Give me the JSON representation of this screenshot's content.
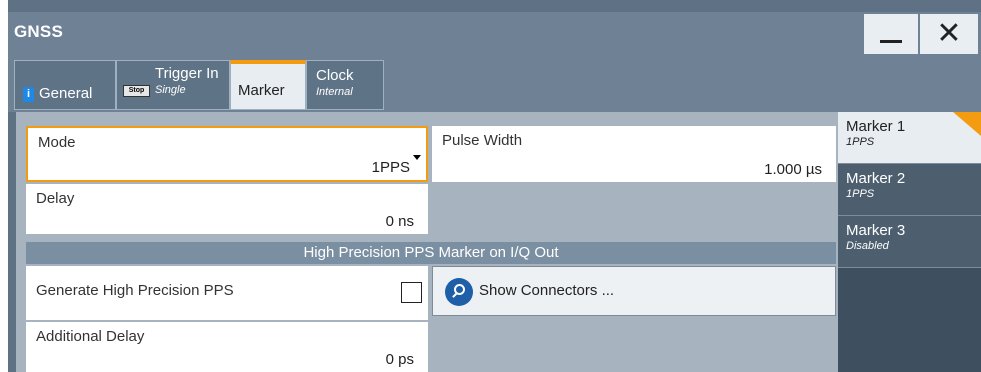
{
  "window": {
    "title": "GNSS",
    "minimize_icon": "minimize-icon",
    "close_icon": "close-icon",
    "close_glyph": "✕"
  },
  "tabs": [
    {
      "label": "General",
      "icon": "info-icon",
      "badge": "i"
    },
    {
      "label": "Trigger In",
      "sub": "Single",
      "icon": "stop-icon",
      "badge": "Stop"
    },
    {
      "label": "Marker",
      "active": true
    },
    {
      "label": "Clock",
      "sub": "Internal"
    }
  ],
  "form": {
    "mode": {
      "label": "Mode",
      "value": "1PPS"
    },
    "pulse_width": {
      "label": "Pulse Width",
      "value": "1.000 µs"
    },
    "delay": {
      "label": "Delay",
      "value": "0 ns"
    },
    "section_title": "High Precision PPS Marker on I/Q Out",
    "generate_hp_pps": {
      "label": "Generate High Precision PPS",
      "checked": false
    },
    "show_connectors": {
      "label": "Show Connectors ...",
      "icon": "search-icon"
    },
    "additional_delay": {
      "label": "Additional Delay",
      "value": "0 ps"
    }
  },
  "markers": [
    {
      "name": "Marker 1",
      "sub": "1PPS",
      "active": true
    },
    {
      "name": "Marker 2",
      "sub": "1PPS"
    },
    {
      "name": "Marker 3",
      "sub": "Disabled"
    }
  ],
  "colors": {
    "accent": "#f39c12",
    "title_bar": "#6e8195",
    "panel": "#a7b4bf",
    "button_blue": "#1e5fa8"
  }
}
